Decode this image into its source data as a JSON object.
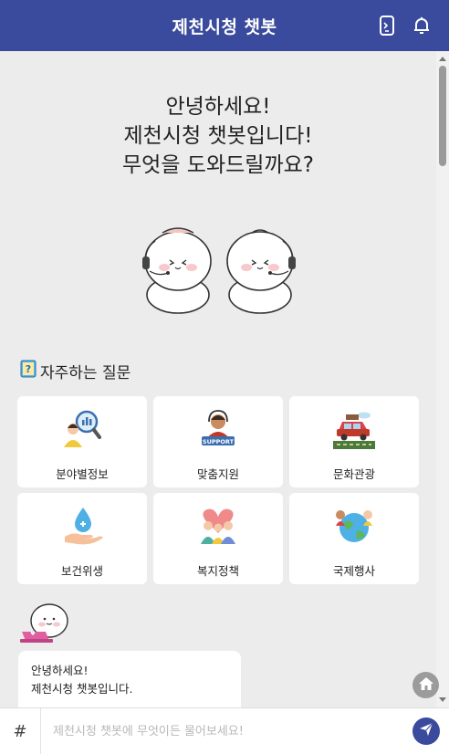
{
  "header": {
    "title": "제천시청 챗봇",
    "icons": [
      "phone-icon",
      "bell-icon"
    ]
  },
  "greeting": {
    "line1": "안녕하세요!",
    "line2": "제천시청 챗봇입니다!",
    "line3": "무엇을 도와드릴까요?"
  },
  "faq": {
    "title": "자주하는 질문",
    "items": [
      {
        "label": "분야별정보",
        "icon": "search-person-icon"
      },
      {
        "label": "맞춤지원",
        "icon": "support-agent-icon"
      },
      {
        "label": "문화관광",
        "icon": "car-travel-icon"
      },
      {
        "label": "보건위생",
        "icon": "water-drop-hand-icon"
      },
      {
        "label": "복지정책",
        "icon": "family-heart-icon"
      },
      {
        "label": "국제행사",
        "icon": "globe-people-icon"
      }
    ],
    "support_badge": "SUPPORT"
  },
  "chat": {
    "message_line1": "안녕하세요!",
    "message_line2": "제천시청 챗봇입니다."
  },
  "input": {
    "hash": "#",
    "placeholder": "제천시청 챗봇에 무엇이든 물어보세요!"
  },
  "colors": {
    "primary": "#3a4a9c",
    "background": "#ececec",
    "card": "#ffffff"
  }
}
